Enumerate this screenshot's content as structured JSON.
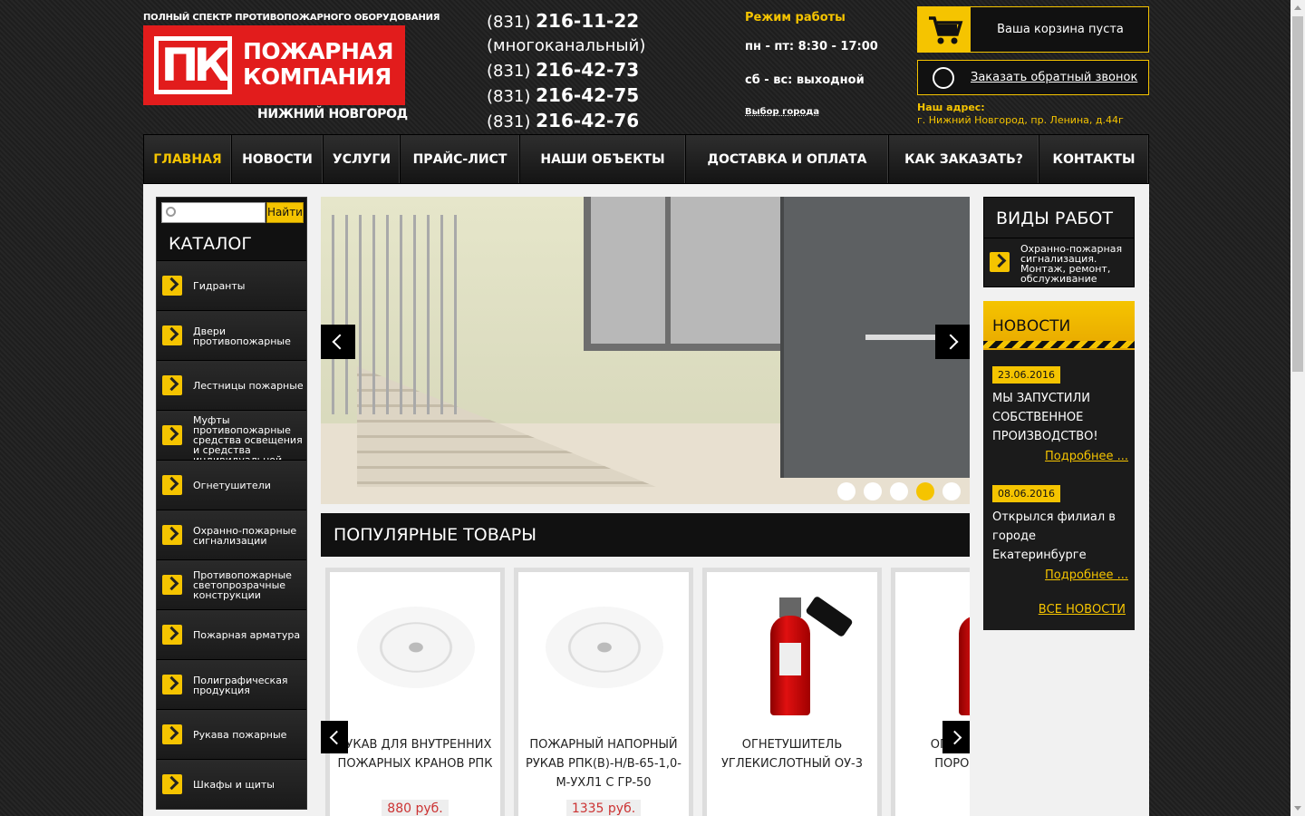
{
  "header": {
    "tagline": "ПОЛНЫЙ СПЕКТР ПРОТИВОПОЖАРНОГО ОБОРУДОВАНИЯ",
    "logo_mark": "ПК",
    "logo_line1": "ПОЖАРНАЯ",
    "logo_line2": "КОМПАНИЯ",
    "logo_city": "НИЖНИЙ НОВГОРОД",
    "phones": [
      {
        "code": "(831)",
        "number": "216-11-22"
      },
      {
        "note": "(многоканальный)"
      },
      {
        "code": "(831)",
        "number": "216-42-73"
      },
      {
        "code": "(831)",
        "number": "216-42-75"
      },
      {
        "code": "(831)",
        "number": "216-42-76"
      }
    ],
    "hours_title": "Режим работы",
    "hours_weekdays": "пн - пт: 8:30 - 17:00",
    "hours_weekend": "сб - вс: выходной",
    "city_select": "Выбор города",
    "cart_label": "Ваша корзина пуста",
    "callback_label": "Заказать обратный звонок",
    "address_title": "Наш адрес:",
    "address": "г. Нижний Новгород, пр. Ленина, д.44г",
    "accent": "#f5c400",
    "brand_red": "#e21c1c"
  },
  "nav": {
    "items": [
      {
        "label": "ГЛАВНАЯ",
        "active": true
      },
      {
        "label": "НОВОСТИ"
      },
      {
        "label": "УСЛУГИ"
      },
      {
        "label": "ПРАЙС-ЛИСТ"
      },
      {
        "label": "НАШИ ОБЪЕКТЫ"
      },
      {
        "label": "ДОСТАВКА И ОПЛАТА"
      },
      {
        "label": "КАК ЗАКАЗАТЬ?"
      },
      {
        "label": "КОНТАКТЫ"
      }
    ]
  },
  "sidebar": {
    "search_placeholder": "",
    "search_button": "Найти",
    "catalog_title": "КАТАЛОГ",
    "items": [
      {
        "label": "Гидранты"
      },
      {
        "label": "Двери противопожарные"
      },
      {
        "label": "Лестницы пожарные"
      },
      {
        "label": "Муфты противопожарные средства освещения и средства индивидуальной"
      },
      {
        "label": "Огнетушители"
      },
      {
        "label": "Охранно-пожарные сигнализации"
      },
      {
        "label": "Противопожарные светопрозрачные конструкции"
      },
      {
        "label": "Пожарная арматура"
      },
      {
        "label": "Полиграфическая продукция"
      },
      {
        "label": "Рукава пожарные"
      },
      {
        "label": "Шкафы и щиты"
      }
    ]
  },
  "slider": {
    "slide_count": 5,
    "active_index": 3
  },
  "popular": {
    "title": "ПОПУЛЯРНЫЕ ТОВАРЫ",
    "products": [
      {
        "name": "РУКАВ ДЛЯ ВНУТРЕННИХ ПОЖАРНЫХ КРАНОВ РПК",
        "price": "880 руб.",
        "image": "fire-hose"
      },
      {
        "name": "ПОЖАРНЫЙ НАПОРНЫЙ РУКАВ РПК(В)-Н/В-65-1,0-М-УХЛ1 С ГР-50",
        "price": "1335 руб.",
        "image": "fire-hose"
      },
      {
        "name": "ОГНЕТУШИТЕЛЬ УГЛЕКИСЛОТНЫЙ ОУ-3",
        "price": "",
        "image": "co2-extinguisher"
      },
      {
        "name": "ОГНЕТУШИТЕЛЬ ПОРОШКОВЫЙ",
        "price": "",
        "image": "powder-extinguisher"
      }
    ]
  },
  "works": {
    "title": "ВИДЫ РАБОТ",
    "items": [
      {
        "label": "Охранно-пожарная сигнализация. Монтаж, ремонт, обслуживание"
      }
    ]
  },
  "news": {
    "title": "НОВОСТИ",
    "items": [
      {
        "date": "23.06.2016",
        "text": "МЫ ЗАПУСТИЛИ СОБСТВЕННОЕ ПРОИЗВОДСТВО!",
        "more": "Подробнее ..."
      },
      {
        "date": "08.06.2016",
        "text": "Открылся филиал в городе Екатеринбурге",
        "more": "Подробнее ..."
      }
    ],
    "all_label": "ВСЕ НОВОСТИ"
  }
}
